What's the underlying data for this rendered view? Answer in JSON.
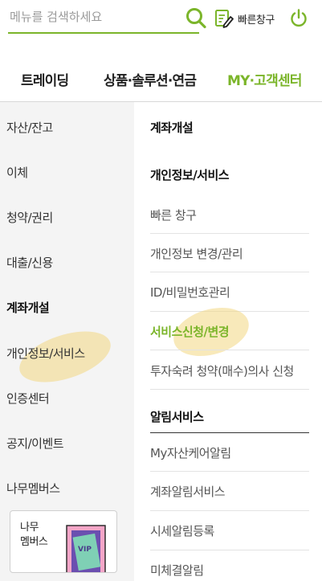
{
  "search": {
    "placeholder": "메뉴를 검색하세요",
    "value": ""
  },
  "header": {
    "quick_label": "빠른창구"
  },
  "tabs": [
    {
      "label": "트레이딩"
    },
    {
      "label": "상품·솔루션·연금"
    },
    {
      "label": "MY·고객센터"
    }
  ],
  "left_menu": [
    {
      "label": "자산/잔고"
    },
    {
      "label": "이체"
    },
    {
      "label": "청약/권리"
    },
    {
      "label": "대출/신용"
    },
    {
      "label": "계좌개설"
    },
    {
      "label": "개인정보/서비스"
    },
    {
      "label": "인증센터"
    },
    {
      "label": "공지/이벤트"
    },
    {
      "label": "나무멤버스"
    }
  ],
  "banner": {
    "text": "나무\n멤버스"
  },
  "right_menu": {
    "section1_title": "계좌개설",
    "section2_title": "개인정보/서비스",
    "section2_items": [
      {
        "label": "빠른 창구"
      },
      {
        "label": "개인정보 변경/관리"
      },
      {
        "label": "ID/비밀번호관리"
      },
      {
        "label": "서비스신청/변경"
      },
      {
        "label": "투자숙려 청약(매수)의사 신청"
      }
    ],
    "section3_title": "알림서비스",
    "section3_items": [
      {
        "label": "My자산케어알림"
      },
      {
        "label": "계좌알림서비스"
      },
      {
        "label": "시세알림등록"
      },
      {
        "label": "미체결알림"
      }
    ]
  },
  "colors": {
    "accent": "#7bb52a",
    "left_bg": "#f4f4f4",
    "highlight": "#f3d782"
  }
}
